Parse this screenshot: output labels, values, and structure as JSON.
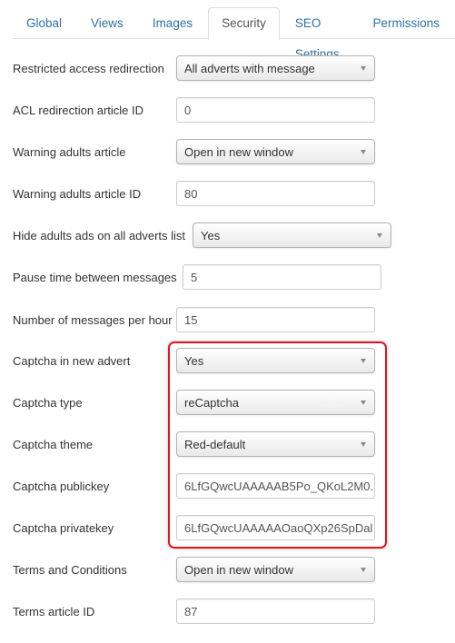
{
  "tabs": [
    {
      "label": "Global",
      "active": false
    },
    {
      "label": "Views",
      "active": false
    },
    {
      "label": "Images",
      "active": false
    },
    {
      "label": "Security",
      "active": true
    },
    {
      "label": "SEO Settings",
      "active": false
    },
    {
      "label": "Permissions",
      "active": false
    }
  ],
  "fields": {
    "restricted_access_redirection": {
      "label": "Restricted access redirection",
      "type": "select",
      "value": "All adverts with message"
    },
    "acl_redirection_article_id": {
      "label": "ACL redirection article ID",
      "type": "input",
      "value": "0"
    },
    "warning_adults_article": {
      "label": "Warning adults article",
      "type": "select",
      "value": "Open in new window"
    },
    "warning_adults_article_id": {
      "label": "Warning adults article ID",
      "type": "input",
      "value": "80"
    },
    "hide_adults_ads": {
      "label": "Hide adults ads on all adverts list",
      "type": "select",
      "value": "Yes"
    },
    "pause_time_between_messages": {
      "label": "Pause time between messages",
      "type": "input",
      "value": "5"
    },
    "messages_per_hour": {
      "label": "Number of messages per hour",
      "type": "input",
      "value": "15"
    },
    "captcha_in_new_advert": {
      "label": "Captcha in new advert",
      "type": "select",
      "value": "Yes"
    },
    "captcha_type": {
      "label": "Captcha type",
      "type": "select",
      "value": "reCaptcha"
    },
    "captcha_theme": {
      "label": "Captcha theme",
      "type": "select",
      "value": "Red-default"
    },
    "captcha_publickey": {
      "label": "Captcha publickey",
      "type": "input",
      "value": "6LfGQwcUAAAAAB5Po_QKoL2M0."
    },
    "captcha_privatekey": {
      "label": "Captcha privatekey",
      "type": "input",
      "value": "6LfGQwcUAAAAAOaoQXp26SpDal"
    },
    "terms_and_conditions": {
      "label": "Terms and Conditions",
      "type": "select",
      "value": "Open in new window"
    },
    "terms_article_id": {
      "label": "Terms article ID",
      "type": "input",
      "value": "87"
    }
  },
  "highlight_color": "#e0161d"
}
